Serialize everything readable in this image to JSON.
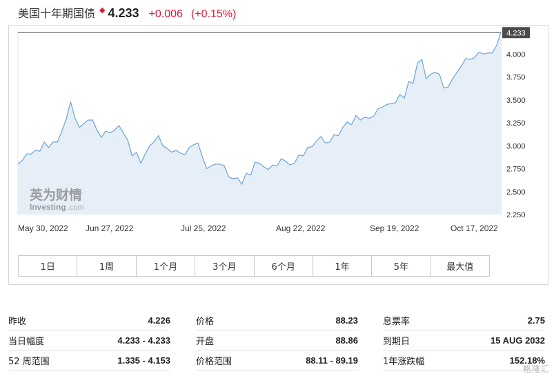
{
  "header": {
    "title": "美国十年期国债",
    "marker": "◆",
    "price": "4.233",
    "change": "+0.006",
    "change_pct": "(+0.15%)",
    "up_color": "#e0193b"
  },
  "chart_data": {
    "type": "area",
    "instrument": "美国十年期国债",
    "x": [
      "May 30, 2022",
      "Jun 27, 2022",
      "Jul 25, 2022",
      "Aug 22, 2022",
      "Sep 19, 2022",
      "Oct 17, 2022"
    ],
    "xticks": [
      "May 30, 2022",
      "Jun 27, 2022",
      "Jul 25, 2022",
      "Aug 22, 2022",
      "Sep 19, 2022",
      "Oct 17, 2022"
    ],
    "yticks": [
      "4.000",
      "3.750",
      "3.500",
      "3.250",
      "3.000",
      "2.750",
      "2.500",
      "2.250"
    ],
    "ylim": [
      2.25,
      4.25
    ],
    "last_value": "4.233",
    "reference_line": 4.233,
    "colors": {
      "line": "#6aa3d8",
      "fill": "#e6eff7",
      "ref": "#555555",
      "label_bg": "#4b4b4b"
    },
    "series": [
      {
        "values": [
          2.8,
          2.84,
          2.91,
          2.91,
          2.95,
          2.94,
          3.04,
          2.98,
          3.04,
          3.04,
          3.16,
          3.29,
          3.48,
          3.3,
          3.2,
          3.24,
          3.28,
          3.28,
          3.17,
          3.09,
          3.16,
          3.14,
          3.17,
          3.22,
          3.14,
          3.06,
          2.89,
          2.93,
          2.81,
          2.91,
          3.0,
          3.04,
          3.11,
          3.0,
          2.97,
          2.93,
          2.95,
          2.92,
          2.9,
          2.98,
          3.01,
          3.03,
          2.88,
          2.75,
          2.78,
          2.8,
          2.8,
          2.78,
          2.66,
          2.64,
          2.65,
          2.58,
          2.7,
          2.68,
          2.82,
          2.81,
          2.77,
          2.74,
          2.79,
          2.78,
          2.86,
          2.83,
          2.79,
          2.81,
          2.9,
          2.89,
          2.98,
          2.99,
          3.05,
          3.1,
          3.03,
          3.04,
          3.12,
          3.11,
          3.2,
          3.26,
          3.23,
          3.33,
          3.28,
          3.31,
          3.3,
          3.32,
          3.4,
          3.42,
          3.45,
          3.46,
          3.47,
          3.56,
          3.52,
          3.7,
          3.68,
          3.9,
          3.94,
          3.73,
          3.78,
          3.8,
          3.78,
          3.63,
          3.64,
          3.73,
          3.8,
          3.87,
          3.95,
          3.94,
          3.96,
          4.02,
          4.0,
          4.01,
          4.01,
          4.09,
          4.233
        ]
      }
    ]
  },
  "logo": {
    "cn": "英为财情",
    "en": "Investing",
    "suffix": ".com"
  },
  "ranges": [
    "1日",
    "1周",
    "1个月",
    "3个月",
    "6个月",
    "1年",
    "5年",
    "最大值"
  ],
  "stats": {
    "col1": [
      {
        "label": "昨收",
        "value": "4.226"
      },
      {
        "label": "当日幅度",
        "value": "4.233 - 4.233"
      },
      {
        "label": "52 周范围",
        "value": "1.335 - 4.153"
      }
    ],
    "col2": [
      {
        "label": "价格",
        "value": "88.23"
      },
      {
        "label": "开盘",
        "value": "88.86"
      },
      {
        "label": "价格范围",
        "value": "88.11 - 89.19"
      }
    ],
    "col3": [
      {
        "label": "息票率",
        "value": "2.75"
      },
      {
        "label": "到期日",
        "value": "15 AUG 2032"
      },
      {
        "label": "1年涨跌幅",
        "value": "152.18%"
      }
    ]
  },
  "watermark": "格隆汇"
}
